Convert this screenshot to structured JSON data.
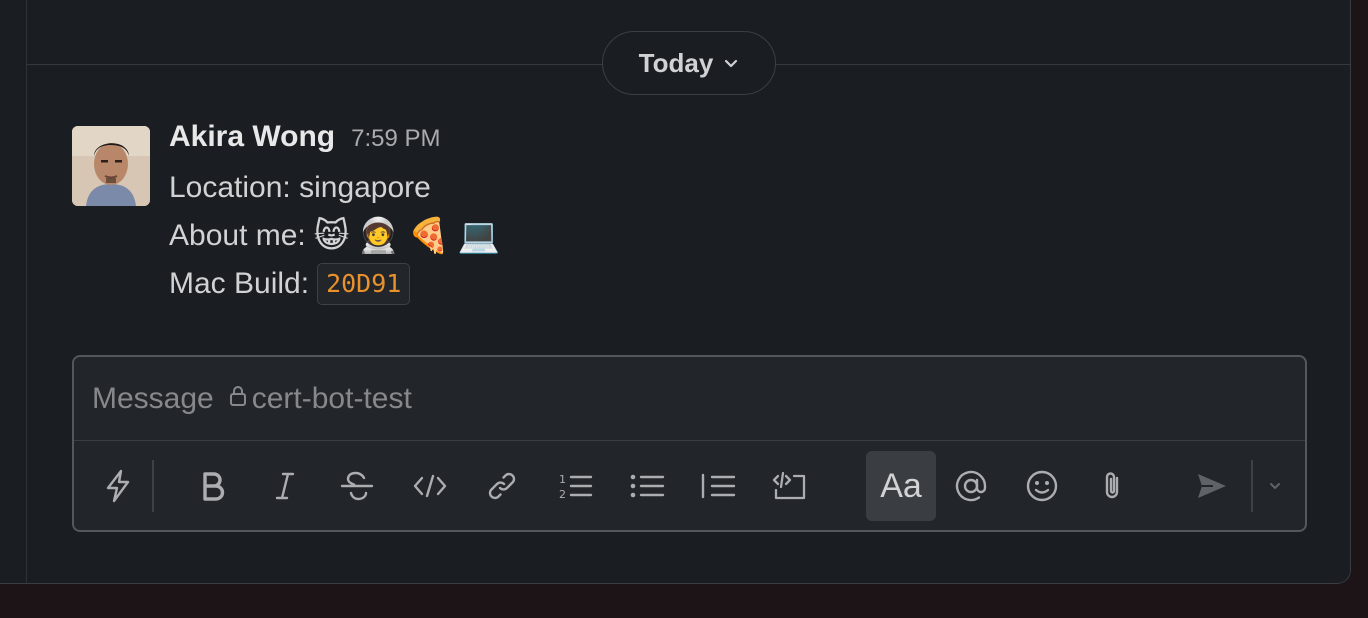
{
  "day_divider": {
    "label": "Today"
  },
  "message": {
    "author": "Akira Wong",
    "time": "7:59 PM",
    "location_text": "Location: singapore",
    "about_label": "About me:",
    "about_emojis": [
      "😸",
      "🧑‍🚀",
      "🍕",
      "💻"
    ],
    "mac_build_label": "Mac Build:",
    "mac_build_value": "20D91"
  },
  "composer": {
    "placeholder": "Message",
    "channel": "cert-bot-test",
    "format_button_label": "Aa"
  },
  "colors": {
    "background": "#1a1d21",
    "text": "#d1d2d3",
    "code_text": "#e8912d",
    "muted": "#86888b"
  }
}
